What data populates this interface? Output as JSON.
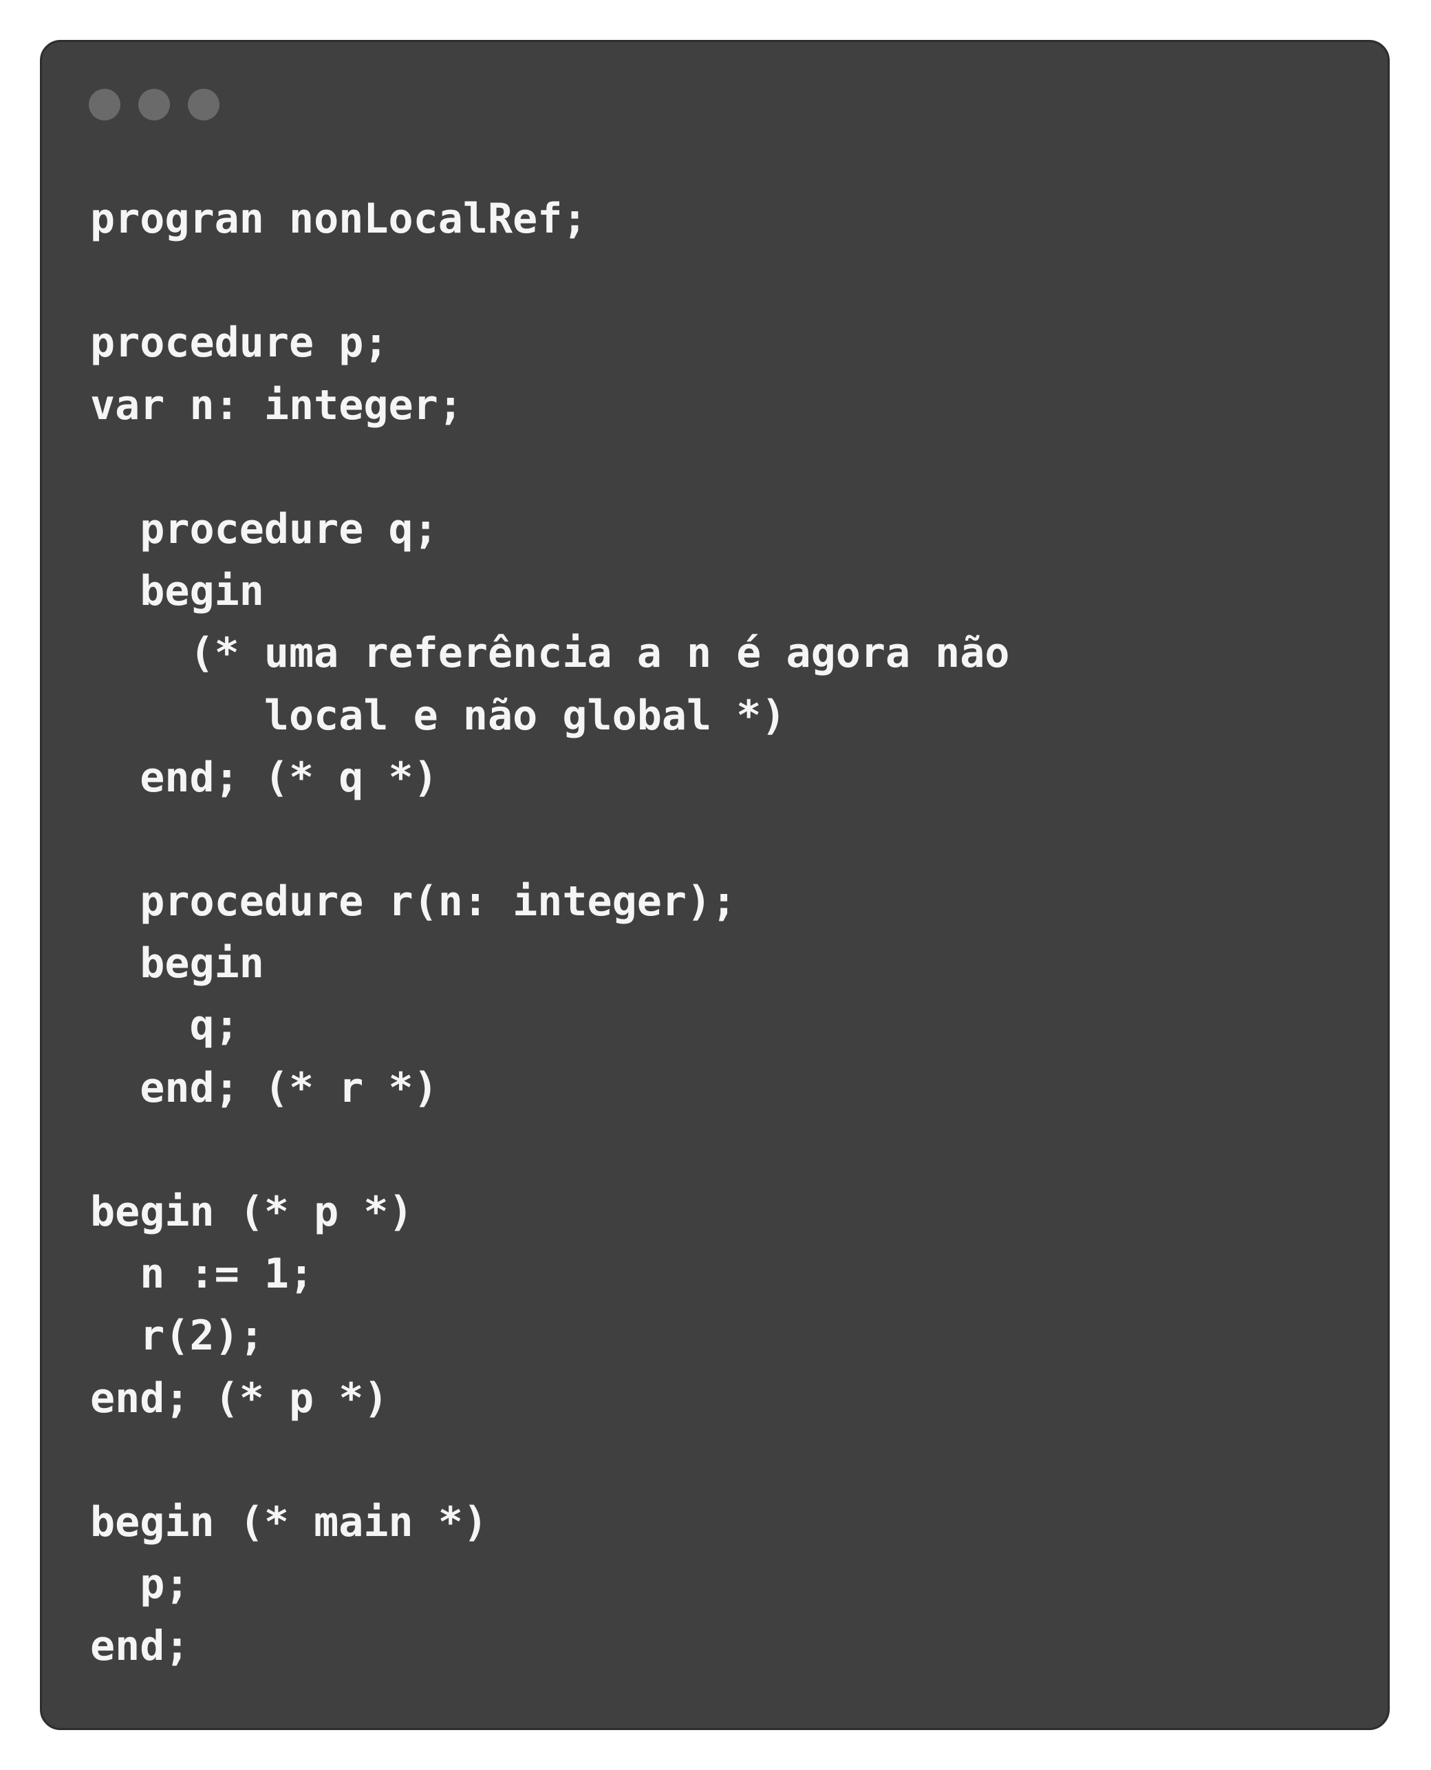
{
  "window": {
    "background_color": "#404040",
    "dot_color": "#6a6a6a",
    "text_color": "#f5f5f5"
  },
  "code": {
    "lines": [
      "progran nonLocalRef;",
      "",
      "procedure p;",
      "var n: integer;",
      "",
      "  procedure q;",
      "  begin",
      "    (* uma referência a n é agora não",
      "       local e não global *)",
      "  end; (* q *)",
      "",
      "  procedure r(n: integer);",
      "  begin",
      "    q;",
      "  end; (* r *)",
      "",
      "begin (* p *)",
      "  n := 1;",
      "  r(2);",
      "end; (* p *)",
      "",
      "begin (* main *)",
      "  p;",
      "end;"
    ]
  }
}
